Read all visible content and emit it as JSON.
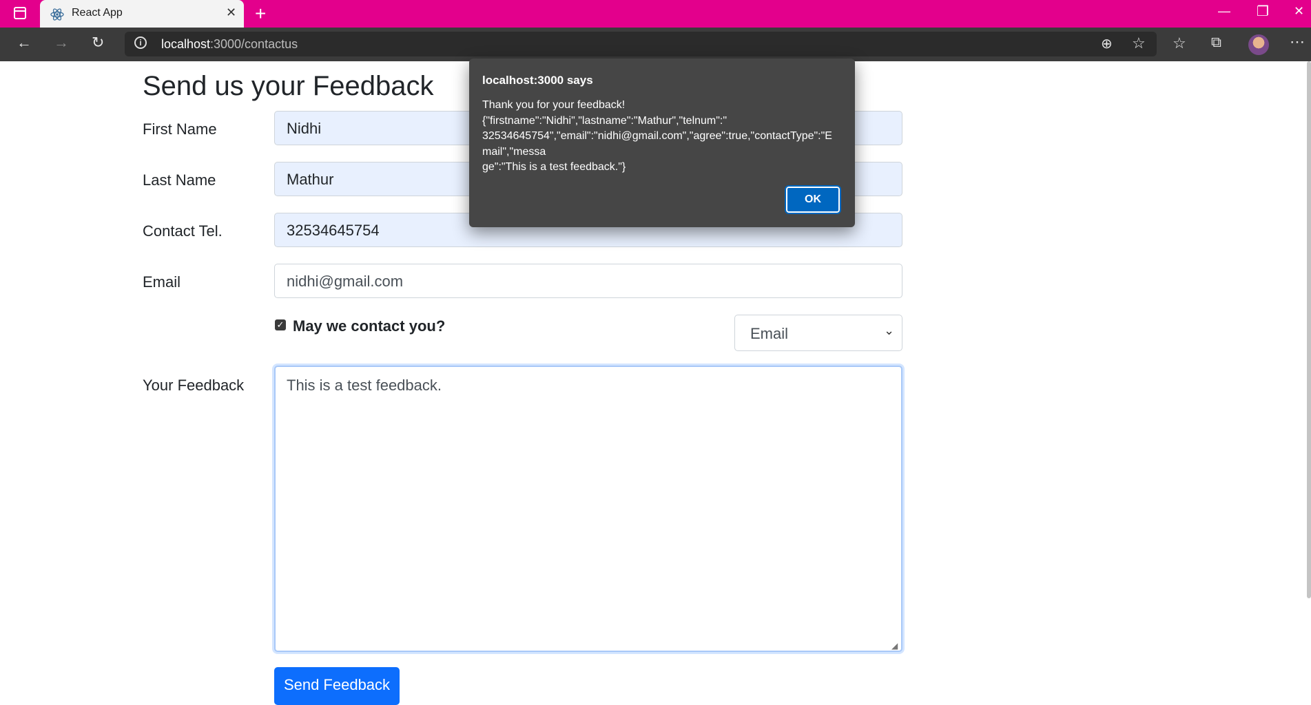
{
  "browser": {
    "tab_title": "React App",
    "url_host": "localhost",
    "url_path": ":3000/contactus"
  },
  "page": {
    "title": "Send us your Feedback",
    "fields": {
      "firstname_label": "First Name",
      "firstname_value": "Nidhi",
      "lastname_label": "Last Name",
      "lastname_value": "Mathur",
      "telnum_label": "Contact Tel.",
      "telnum_value": "32534645754",
      "email_label": "Email",
      "email_value": "nidhi@gmail.com",
      "agree_label": "May we contact you?",
      "agree_checked": true,
      "contact_type": "Email",
      "feedback_label": "Your Feedback",
      "feedback_value": "This is a test feedback."
    },
    "submit_label": "Send Feedback"
  },
  "dialog": {
    "title": "localhost:3000 says",
    "line1": "Thank you for your feedback!",
    "line2": "{\"firstname\":\"Nidhi\",\"lastname\":\"Mathur\",\"telnum\":\"",
    "line3": "32534645754\",\"email\":\"nidhi@gmail.com\",\"agree\":true,\"contactType\":\"E",
    "line4": "mail\",\"messa",
    "line5": "ge\":\"This is a test feedback.\"}",
    "ok_label": "OK"
  },
  "icons": {
    "titlebar_color": "#e3008c",
    "accent": "#0d6efd"
  }
}
